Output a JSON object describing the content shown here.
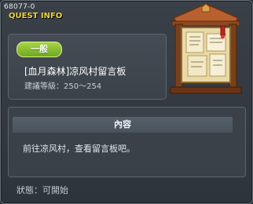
{
  "quest": {
    "id": "68077-0",
    "header": "QUEST INFO",
    "category": "一般",
    "title": "[血月森林]凉风村留言板",
    "level_req": "建議等級：250～254"
  },
  "content": {
    "header": "內容",
    "text": "前往凉风村，查看留言板吧。"
  },
  "status": "狀態：可開始",
  "colors": {
    "header_text": "#f0d040",
    "badge": "#8cc43a",
    "panel": "#3b4149"
  },
  "icons": {
    "board": "notice-board-icon"
  }
}
